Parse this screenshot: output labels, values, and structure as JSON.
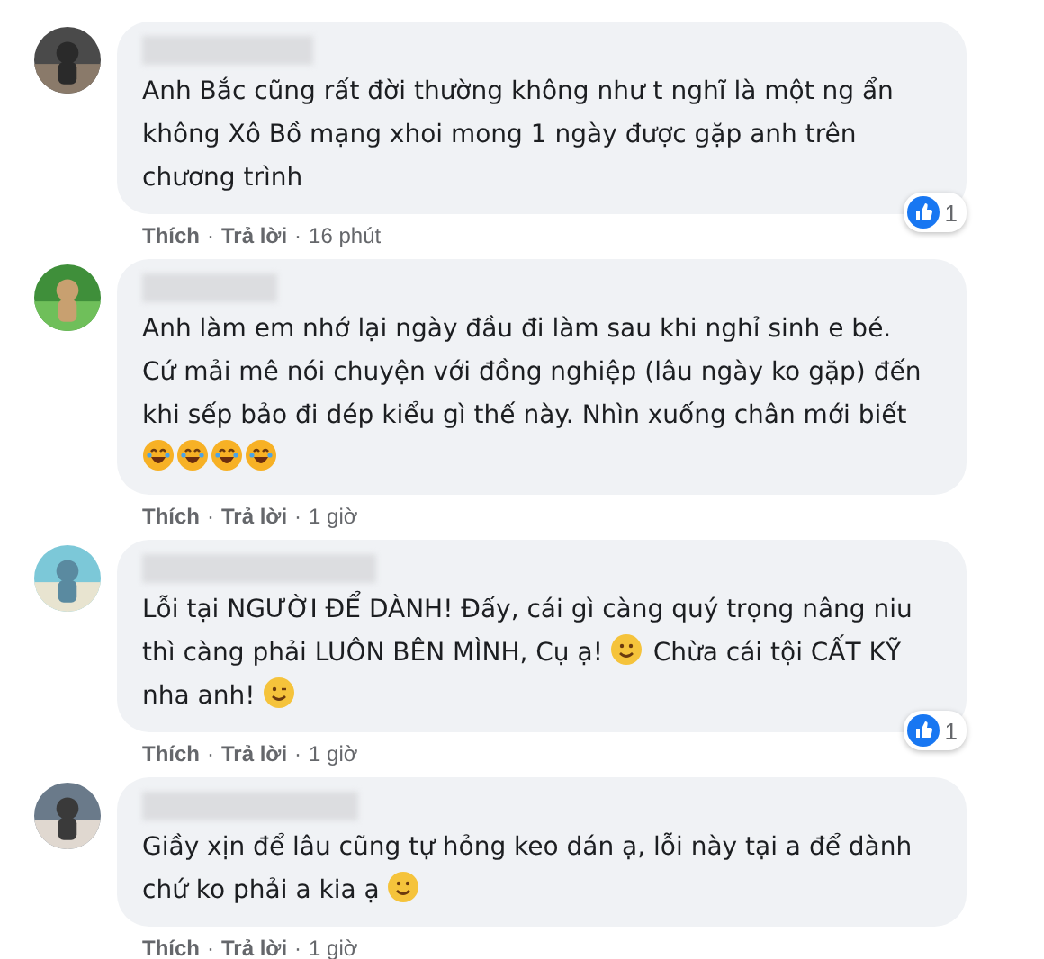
{
  "comments": [
    {
      "avatar": {
        "kind": "picture"
      },
      "segments": [
        {
          "kind": "text",
          "text": "Anh Bắc cũng rất đời thường không như t nghĩ là một ng ẩn không Xô Bồ mạng xhoi mong 1 ngày được gặp anh trên chương trình"
        }
      ],
      "actions": {
        "like": "Thích",
        "separator": "·",
        "reply": "Trả lời",
        "time": "16 phút"
      },
      "reactions": "1"
    },
    {
      "avatar": {
        "kind": "picture"
      },
      "segments": [
        {
          "kind": "text",
          "text": "Anh làm em nhớ lại ngày đầu đi làm sau khi nghỉ sinh e bé. Cứ mải mê nói chuyện với đồng nghiệp (lâu ngày ko gặp) đến khi sếp bảo đi dép kiểu gì thế này. Nhìn xuống chân mới biết "
        },
        {
          "kind": "laugh"
        },
        {
          "kind": "laugh"
        },
        {
          "kind": "laugh"
        },
        {
          "kind": "laugh"
        }
      ],
      "actions": {
        "like": "Thích",
        "separator": "·",
        "reply": "Trả lời",
        "time": "1 giờ"
      }
    },
    {
      "avatar": {
        "kind": "picture"
      },
      "segments": [
        {
          "kind": "text",
          "text": "Lỗi tại NGƯỜI ĐỂ DÀNH! Đấy, cái gì càng quý trọng nâng niu thì càng phải LUÔN BÊN MÌNH, Cụ ạ! "
        },
        {
          "kind": "smile"
        },
        {
          "kind": "text",
          "text": " Chừa cái tội CẤT KỸ nha anh! "
        },
        {
          "kind": "wink"
        }
      ],
      "actions": {
        "like": "Thích",
        "separator": "·",
        "reply": "Trả lời",
        "time": "1 giờ"
      },
      "reactions": "1"
    },
    {
      "avatar": {
        "kind": "picture"
      },
      "segments": [
        {
          "kind": "text",
          "text": "Giầy xịn để lâu cũng tự hỏng keo dán ạ, lỗi này tại a để dành chứ ko phải a kia ạ "
        },
        {
          "kind": "smile"
        }
      ],
      "actions": {
        "like": "Thích",
        "separator": "·",
        "reply": "Trả lời",
        "time": "1 giờ"
      }
    }
  ]
}
